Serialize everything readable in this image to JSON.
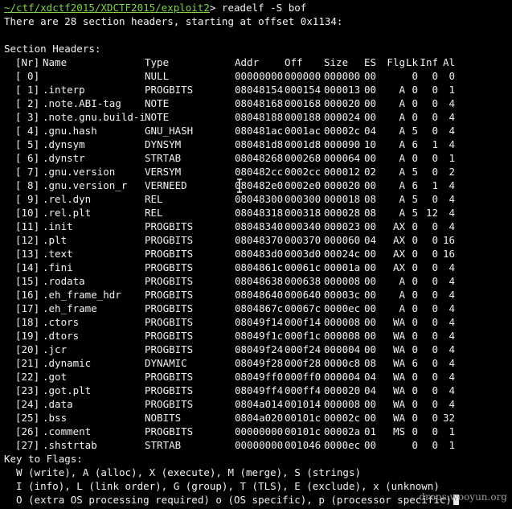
{
  "prompt": {
    "path": "~/ctf/xdctf2015/XDCTF2015/exploit2",
    "symbol": ">",
    "command": " readelf -S bof"
  },
  "summary": "There are 28 section headers, starting at offset 0x1134:",
  "section_title": "Section Headers:",
  "columns": {
    "nr": "[Nr]",
    "name": "Name",
    "type": "Type",
    "addr": "Addr",
    "off": "Off",
    "size": "Size",
    "es": "ES",
    "flg": "Flg",
    "lk": "Lk",
    "inf": "Inf",
    "al": "Al"
  },
  "sections": [
    {
      "nr": "[ 0]",
      "name": "",
      "type": "NULL",
      "addr": "00000000",
      "off": "000000",
      "size": "000000",
      "es": "00",
      "flg": "",
      "lk": "0",
      "inf": "0",
      "al": "0"
    },
    {
      "nr": "[ 1]",
      "name": ".interp",
      "type": "PROGBITS",
      "addr": "08048154",
      "off": "000154",
      "size": "000013",
      "es": "00",
      "flg": "A",
      "lk": "0",
      "inf": "0",
      "al": "1"
    },
    {
      "nr": "[ 2]",
      "name": ".note.ABI-tag",
      "type": "NOTE",
      "addr": "08048168",
      "off": "000168",
      "size": "000020",
      "es": "00",
      "flg": "A",
      "lk": "0",
      "inf": "0",
      "al": "4"
    },
    {
      "nr": "[ 3]",
      "name": ".note.gnu.build-i",
      "type": "NOTE",
      "addr": "08048188",
      "off": "000188",
      "size": "000024",
      "es": "00",
      "flg": "A",
      "lk": "0",
      "inf": "0",
      "al": "4"
    },
    {
      "nr": "[ 4]",
      "name": ".gnu.hash",
      "type": "GNU_HASH",
      "addr": "080481ac",
      "off": "0001ac",
      "size": "00002c",
      "es": "04",
      "flg": "A",
      "lk": "5",
      "inf": "0",
      "al": "4"
    },
    {
      "nr": "[ 5]",
      "name": ".dynsym",
      "type": "DYNSYM",
      "addr": "080481d8",
      "off": "0001d8",
      "size": "000090",
      "es": "10",
      "flg": "A",
      "lk": "6",
      "inf": "1",
      "al": "4"
    },
    {
      "nr": "[ 6]",
      "name": ".dynstr",
      "type": "STRTAB",
      "addr": "08048268",
      "off": "000268",
      "size": "000064",
      "es": "00",
      "flg": "A",
      "lk": "0",
      "inf": "0",
      "al": "1"
    },
    {
      "nr": "[ 7]",
      "name": ".gnu.version",
      "type": "VERSYM",
      "addr": "080482cc",
      "off": "0002cc",
      "size": "000012",
      "es": "02",
      "flg": "A",
      "lk": "5",
      "inf": "0",
      "al": "2"
    },
    {
      "nr": "[ 8]",
      "name": ".gnu.version_r",
      "type": "VERNEED",
      "addr": "080482e0",
      "off": "0002e0",
      "size": "000020",
      "es": "00",
      "flg": "A",
      "lk": "6",
      "inf": "1",
      "al": "4"
    },
    {
      "nr": "[ 9]",
      "name": ".rel.dyn",
      "type": "REL",
      "addr": "08048300",
      "off": "000300",
      "size": "000018",
      "es": "08",
      "flg": "A",
      "lk": "5",
      "inf": "0",
      "al": "4"
    },
    {
      "nr": "[10]",
      "name": ".rel.plt",
      "type": "REL",
      "addr": "08048318",
      "off": "000318",
      "size": "000028",
      "es": "08",
      "flg": "A",
      "lk": "5",
      "inf": "12",
      "al": "4"
    },
    {
      "nr": "[11]",
      "name": ".init",
      "type": "PROGBITS",
      "addr": "08048340",
      "off": "000340",
      "size": "000023",
      "es": "00",
      "flg": "AX",
      "lk": "0",
      "inf": "0",
      "al": "4"
    },
    {
      "nr": "[12]",
      "name": ".plt",
      "type": "PROGBITS",
      "addr": "08048370",
      "off": "000370",
      "size": "000060",
      "es": "04",
      "flg": "AX",
      "lk": "0",
      "inf": "0",
      "al": "16"
    },
    {
      "nr": "[13]",
      "name": ".text",
      "type": "PROGBITS",
      "addr": "080483d0",
      "off": "0003d0",
      "size": "00024c",
      "es": "00",
      "flg": "AX",
      "lk": "0",
      "inf": "0",
      "al": "16"
    },
    {
      "nr": "[14]",
      "name": ".fini",
      "type": "PROGBITS",
      "addr": "0804861c",
      "off": "00061c",
      "size": "00001a",
      "es": "00",
      "flg": "AX",
      "lk": "0",
      "inf": "0",
      "al": "4"
    },
    {
      "nr": "[15]",
      "name": ".rodata",
      "type": "PROGBITS",
      "addr": "08048638",
      "off": "000638",
      "size": "000008",
      "es": "00",
      "flg": "A",
      "lk": "0",
      "inf": "0",
      "al": "4"
    },
    {
      "nr": "[16]",
      "name": ".eh_frame_hdr",
      "type": "PROGBITS",
      "addr": "08048640",
      "off": "000640",
      "size": "00003c",
      "es": "00",
      "flg": "A",
      "lk": "0",
      "inf": "0",
      "al": "4"
    },
    {
      "nr": "[17]",
      "name": ".eh_frame",
      "type": "PROGBITS",
      "addr": "0804867c",
      "off": "00067c",
      "size": "0000ec",
      "es": "00",
      "flg": "A",
      "lk": "0",
      "inf": "0",
      "al": "4"
    },
    {
      "nr": "[18]",
      "name": ".ctors",
      "type": "PROGBITS",
      "addr": "08049f14",
      "off": "000f14",
      "size": "000008",
      "es": "00",
      "flg": "WA",
      "lk": "0",
      "inf": "0",
      "al": "4"
    },
    {
      "nr": "[19]",
      "name": ".dtors",
      "type": "PROGBITS",
      "addr": "08049f1c",
      "off": "000f1c",
      "size": "000008",
      "es": "00",
      "flg": "WA",
      "lk": "0",
      "inf": "0",
      "al": "4"
    },
    {
      "nr": "[20]",
      "name": ".jcr",
      "type": "PROGBITS",
      "addr": "08049f24",
      "off": "000f24",
      "size": "000004",
      "es": "00",
      "flg": "WA",
      "lk": "0",
      "inf": "0",
      "al": "4"
    },
    {
      "nr": "[21]",
      "name": ".dynamic",
      "type": "DYNAMIC",
      "addr": "08049f28",
      "off": "000f28",
      "size": "0000c8",
      "es": "08",
      "flg": "WA",
      "lk": "6",
      "inf": "0",
      "al": "4"
    },
    {
      "nr": "[22]",
      "name": ".got",
      "type": "PROGBITS",
      "addr": "08049ff0",
      "off": "000ff0",
      "size": "000004",
      "es": "04",
      "flg": "WA",
      "lk": "0",
      "inf": "0",
      "al": "4"
    },
    {
      "nr": "[23]",
      "name": ".got.plt",
      "type": "PROGBITS",
      "addr": "08049ff4",
      "off": "000ff4",
      "size": "000020",
      "es": "04",
      "flg": "WA",
      "lk": "0",
      "inf": "0",
      "al": "4"
    },
    {
      "nr": "[24]",
      "name": ".data",
      "type": "PROGBITS",
      "addr": "0804a014",
      "off": "001014",
      "size": "000008",
      "es": "00",
      "flg": "WA",
      "lk": "0",
      "inf": "0",
      "al": "4"
    },
    {
      "nr": "[25]",
      "name": ".bss",
      "type": "NOBITS",
      "addr": "0804a020",
      "off": "00101c",
      "size": "00002c",
      "es": "00",
      "flg": "WA",
      "lk": "0",
      "inf": "0",
      "al": "32"
    },
    {
      "nr": "[26]",
      "name": ".comment",
      "type": "PROGBITS",
      "addr": "00000000",
      "off": "00101c",
      "size": "00002a",
      "es": "01",
      "flg": "MS",
      "lk": "0",
      "inf": "0",
      "al": "1"
    },
    {
      "nr": "[27]",
      "name": ".shstrtab",
      "type": "STRTAB",
      "addr": "00000000",
      "off": "001046",
      "size": "0000ec",
      "es": "00",
      "flg": "",
      "lk": "0",
      "inf": "0",
      "al": "1"
    }
  ],
  "key_title": "Key to Flags:",
  "key_lines": [
    "  W (write), A (alloc), X (execute), M (merge), S (strings)",
    "  I (info), L (link order), G (group), T (TLS), E (exclude), x (unknown)",
    "  O (extra OS processing required) o (OS specific), p (processor specific)"
  ],
  "watermark": "drops.wooyun.org",
  "colors": {
    "background": "#000000",
    "text": "#f2f2f2",
    "prompt_path": "#7fd344"
  },
  "icons": {
    "pointer": "mouse-ibeam-icon"
  }
}
